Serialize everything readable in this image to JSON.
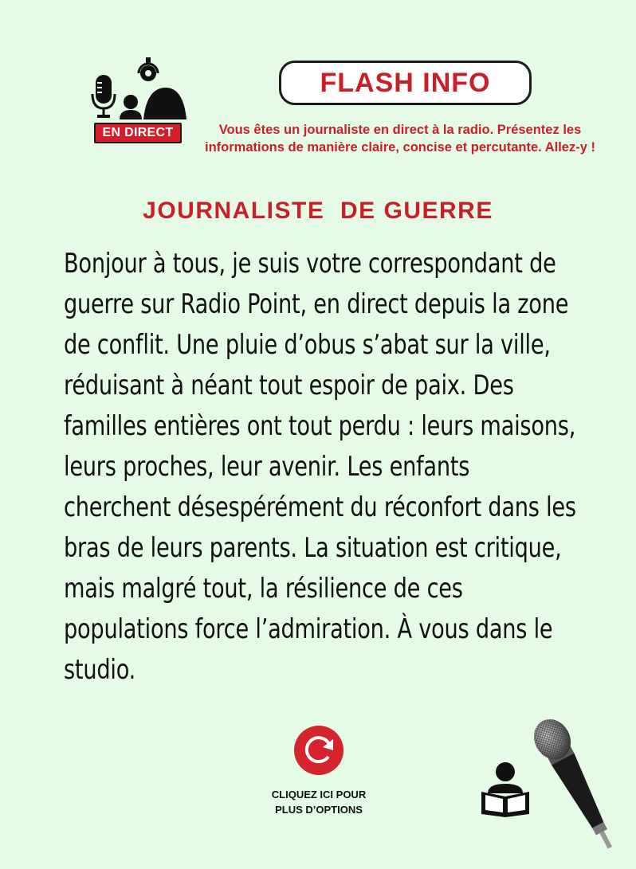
{
  "header": {
    "live_badge": "EN DIRECT",
    "flash_title": "FLASH INFO",
    "intro": "Vous êtes un journaliste en direct à la radio. Présentez les informations de manière claire, concise et percutante. Allez-y !"
  },
  "role": {
    "title": "JOURNALISTE  DE GUERRE"
  },
  "message": {
    "text": "Bonjour à tous, je suis votre correspondant de guerre sur Radio Point, en direct depuis la zone de conflit. Une pluie d’obus s’abat sur la ville, réduisant à néant tout espoir de paix. Des familles entières ont tout perdu : leurs maisons, leurs proches, leur avenir. Les enfants cherchent désespérément du réconfort dans les bras de leurs parents. La situation est critique, mais malgré tout, la résilience de ces populations force l’admiration. À vous dans le studio."
  },
  "footer": {
    "options_label_line1": "CLIQUEZ ICI POUR",
    "options_label_line2": "PLUS D’OPTIONS"
  },
  "icons": {
    "logo": "radio-host-microphone-icon",
    "options": "refresh-icon",
    "reader": "person-reading-icon",
    "microphone": "handheld-microphone-icon"
  },
  "colors": {
    "background": "#e5fbe5",
    "accent_red": "#c8202a",
    "text": "#111111"
  }
}
